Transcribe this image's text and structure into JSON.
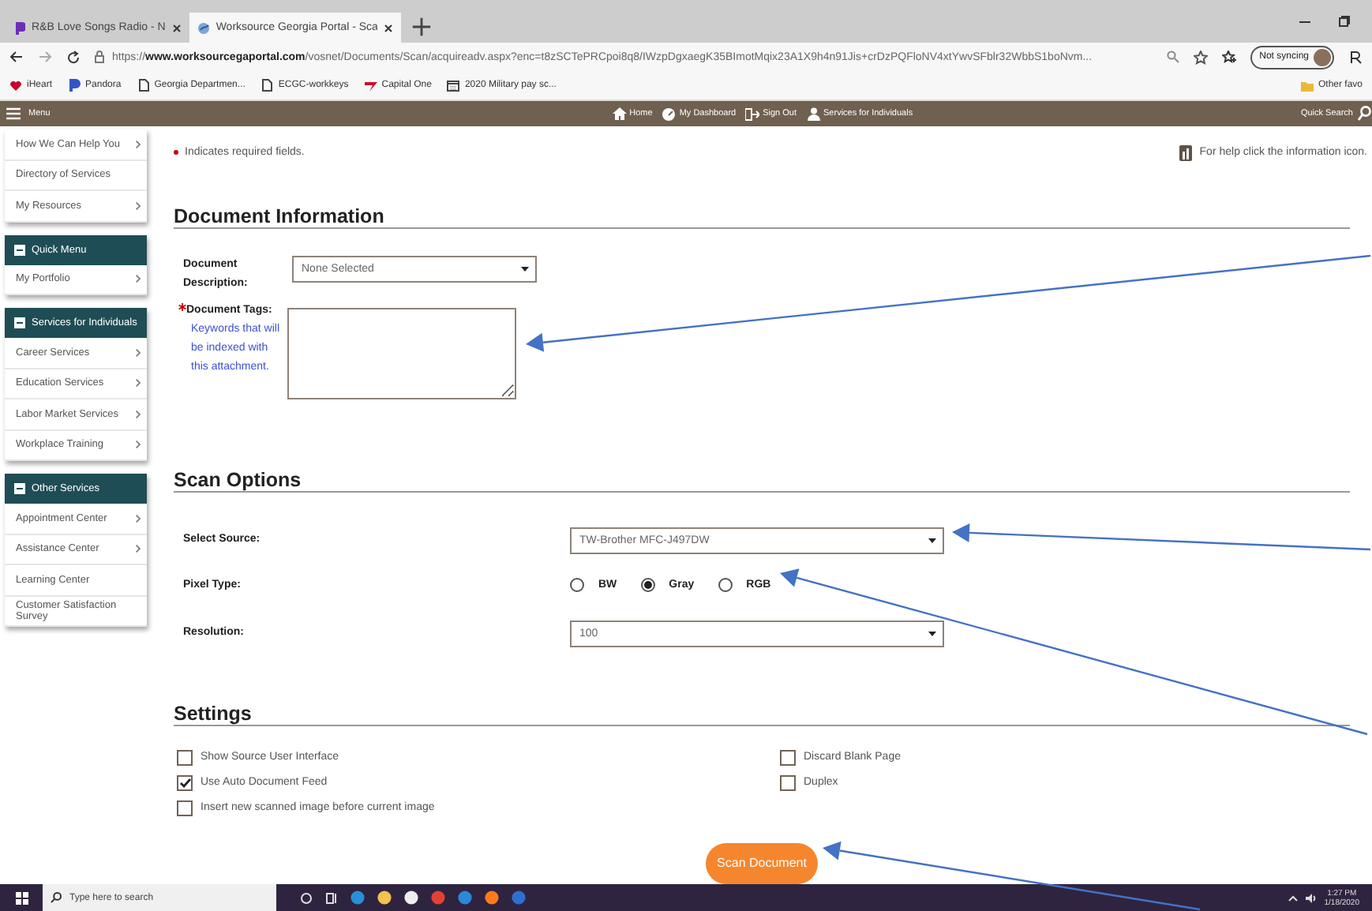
{
  "browser": {
    "tabs": [
      {
        "title": "R&B Love Songs Radio - N",
        "selected": false
      },
      {
        "title": "Worksource Georgia Portal - Sca",
        "selected": true
      }
    ],
    "address": "https://**www.worksourcegaportal.com**/vosnet/Documents/Scan/acquireadv.aspx?enc=t8zSCTePRCpoi8q8/IWzpDgxaegK35BImotMqix23A1X9h4n91Jis+crDzPQFloNV4xtYwvSFblr32WbbS1boNvm...",
    "sync_label": "Not syncing",
    "bookmarks": [
      {
        "label": "iHeart",
        "kind": "heart"
      },
      {
        "label": "Pandora",
        "kind": "pandora"
      },
      {
        "label": "Georgia Departmen...",
        "kind": "page"
      },
      {
        "label": "ECGC-workkeys",
        "kind": "page"
      },
      {
        "label": "Capital One",
        "kind": "swoosh"
      },
      {
        "label": "2020 Military pay sc...",
        "kind": "calendar"
      }
    ],
    "other_bookmarks": "Other favo"
  },
  "site_nav": {
    "menu": "Menu",
    "links": [
      {
        "label": "Home",
        "kind": "home"
      },
      {
        "label": "My Dashboard",
        "kind": "dashboard"
      },
      {
        "label": "Sign Out",
        "kind": "signout"
      },
      {
        "label": "Services for Individuals",
        "kind": "person"
      }
    ],
    "quick_search": "Quick Search"
  },
  "sidebar": {
    "groups": [
      {
        "items": [
          {
            "label": "How We Can Help You",
            "submenu": true
          },
          {
            "label": "Directory of Services",
            "submenu": false
          },
          {
            "label": "My Resources",
            "submenu": true
          }
        ]
      },
      {
        "header": "Quick Menu",
        "items": [
          {
            "label": "My Portfolio",
            "submenu": true
          }
        ]
      },
      {
        "header": "Services for Individuals",
        "items": [
          {
            "label": "Career Services",
            "submenu": true
          },
          {
            "label": "Education Services",
            "submenu": true
          },
          {
            "label": "Labor Market Services",
            "submenu": true
          },
          {
            "label": "Workplace Training",
            "submenu": true
          }
        ]
      },
      {
        "header": "Other Services",
        "items": [
          {
            "label": "Appointment Center",
            "submenu": true
          },
          {
            "label": "Assistance Center",
            "submenu": true
          },
          {
            "label": "Learning Center",
            "submenu": false
          },
          {
            "label": "Customer Satisfaction Survey",
            "submenu": false
          }
        ]
      }
    ]
  },
  "form": {
    "required_note": "Indicates required fields.",
    "help_text": "For help click the information icon.",
    "document_information": {
      "title": "Document Information",
      "description_label": "Document Description:",
      "description_value": "None Selected",
      "tags_label": "Document Tags:",
      "tags_required": true,
      "tags_hint": "Keywords that will be indexed with this attachment."
    },
    "scan_options": {
      "title": "Scan Options",
      "source_label": "Select Source:",
      "source_value": "TW-Brother MFC-J497DW",
      "pixel_label": "Pixel Type:",
      "pixel_types": [
        {
          "label": "BW",
          "selected": false
        },
        {
          "label": "Gray",
          "selected": true
        },
        {
          "label": "RGB",
          "selected": false
        }
      ],
      "resolution_label": "Resolution:",
      "resolution_value": "100"
    },
    "settings": {
      "title": "Settings",
      "left_options": [
        {
          "label": "Show Source User Interface",
          "checked": false
        },
        {
          "label": "Use Auto Document Feed",
          "checked": true
        },
        {
          "label": "Insert new scanned image before current image",
          "checked": false
        }
      ],
      "right_options": [
        {
          "label": "Discard Blank Page",
          "checked": false
        },
        {
          "label": "Duplex",
          "checked": false
        }
      ]
    },
    "submit": "Scan Document"
  },
  "taskbar": {
    "search_placeholder": "Type here to search",
    "time": "1:27 PM",
    "date": "1/18/2020"
  }
}
